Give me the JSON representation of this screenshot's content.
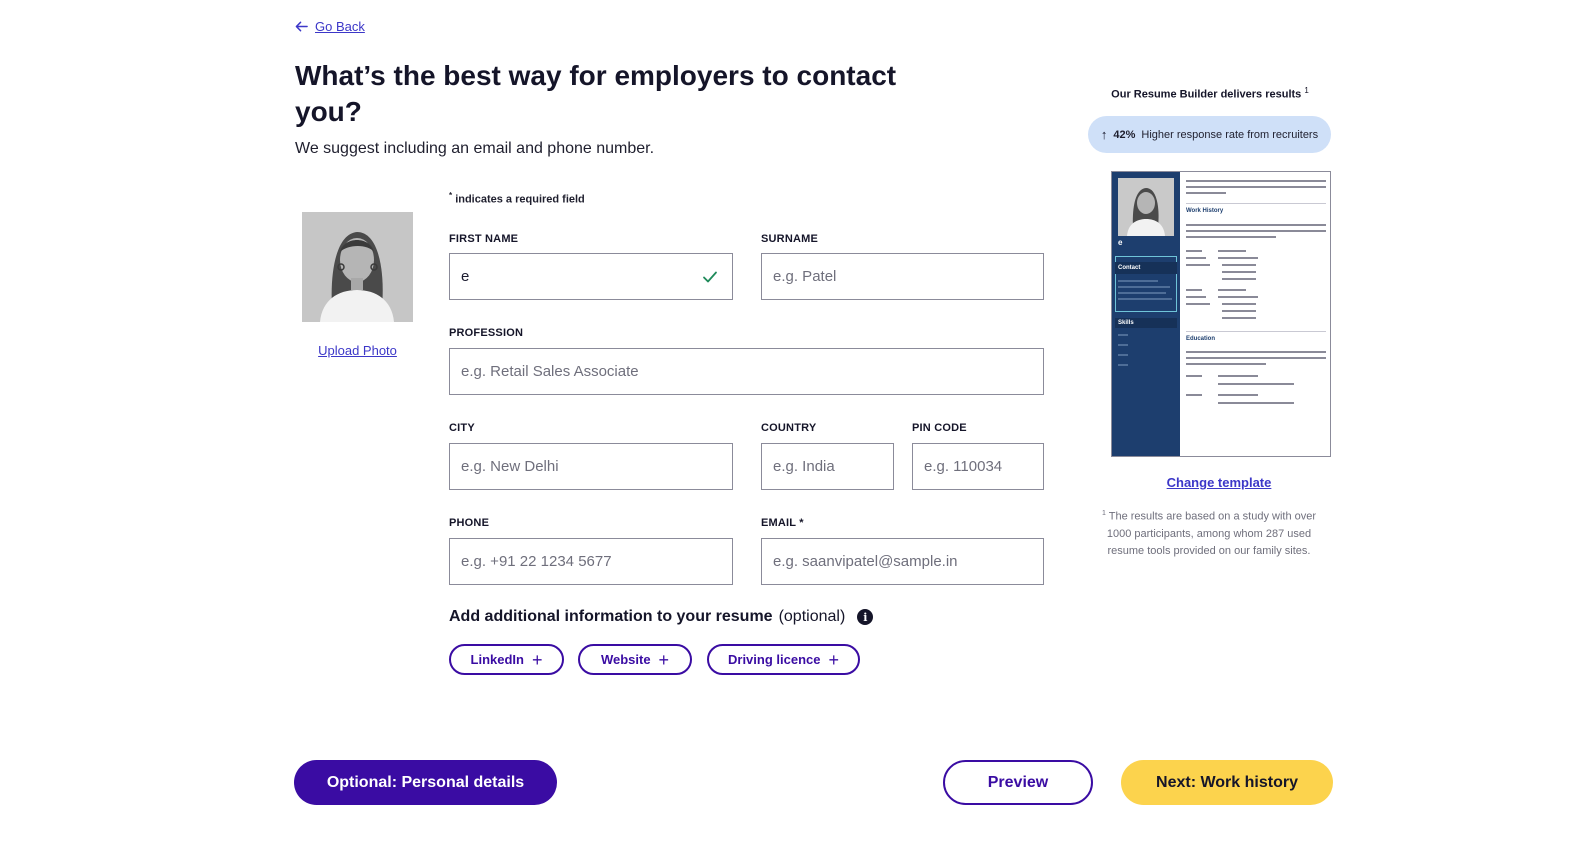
{
  "nav": {
    "go_back": "Go Back"
  },
  "page": {
    "heading": "What’s the best way for employers to contact you?",
    "subheading": "We suggest including an email and phone number."
  },
  "photo": {
    "upload_label": "Upload Photo"
  },
  "form": {
    "required_note": "indicates a required field",
    "required_marker": "*",
    "first_name": {
      "label": "FIRST NAME",
      "value": "e",
      "placeholder": "",
      "valid": true
    },
    "surname": {
      "label": "SURNAME",
      "value": "",
      "placeholder": "e.g. Patel"
    },
    "profession": {
      "label": "PROFESSION",
      "value": "",
      "placeholder": "e.g. Retail Sales Associate"
    },
    "city": {
      "label": "CITY",
      "value": "",
      "placeholder": "e.g. New Delhi"
    },
    "country": {
      "label": "COUNTRY",
      "value": "",
      "placeholder": "e.g. India"
    },
    "pin_code": {
      "label": "PIN CODE",
      "value": "",
      "placeholder": "e.g. 110034"
    },
    "phone": {
      "label": "PHONE",
      "value": "",
      "placeholder": "e.g. +91 22 1234 5677"
    },
    "email": {
      "label": "EMAIL *",
      "value": "",
      "placeholder": "e.g. saanvipatel@sample.in"
    }
  },
  "additional": {
    "title_bold": "Add additional information to your resume",
    "title_rest": "(optional)",
    "info_icon": "i",
    "chips": [
      {
        "label": "LinkedIn",
        "icon": "+"
      },
      {
        "label": "Website",
        "icon": "+"
      },
      {
        "label": "Driving licence",
        "icon": "+"
      }
    ]
  },
  "footer": {
    "optional_button": "Optional: Personal details",
    "preview_button": "Preview",
    "next_button": "Next: Work history"
  },
  "sidebar": {
    "results_title": "Our Resume Builder delivers results",
    "results_marker": "1",
    "badge_arrow": "↑",
    "badge_value": "42%",
    "badge_text": "Higher response rate from recruiters",
    "template_name": "e",
    "template_contact": "Contact",
    "template_skills": "Skills",
    "template_work_history": "Work History",
    "template_education": "Education",
    "change_template": "Change template",
    "footnote_marker": "1",
    "footnote": "The results are based on a study with over 1000 participants, among whom 287 used resume tools provided on our family sites."
  },
  "colors": {
    "primary": "#3a0ca3",
    "accent_yellow": "#fcd34d",
    "link": "#3c37c8",
    "badge_bg": "#cfe0f8",
    "template_sidebar": "#1d3e6e",
    "valid_check": "#1f8a5a"
  }
}
